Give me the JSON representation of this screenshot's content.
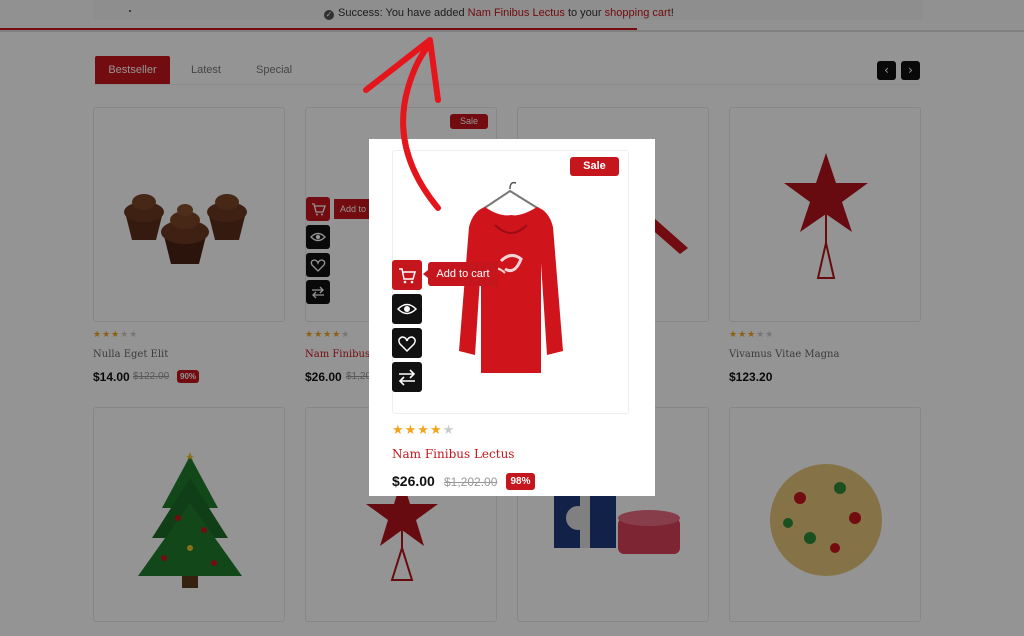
{
  "alert": {
    "prefix": "Success: You have added",
    "product_link": "Nam Finibus Lectus",
    "middle": "to your",
    "cart_link": "shopping cart",
    "suffix": "!"
  },
  "tabs": [
    {
      "label": "Bestseller"
    },
    {
      "label": "Latest"
    },
    {
      "label": "Special"
    }
  ],
  "nav": {
    "prev": "‹",
    "next": "›"
  },
  "products": [
    {
      "name": "Nulla Eget Elit",
      "price": "$14.00",
      "old_price": "$122.00",
      "discount": "90%",
      "rating": 3
    },
    {
      "name": "Nam Finibus",
      "price": "$26.00",
      "old_price": "$1,20",
      "rating": 4
    },
    {
      "name": "",
      "price": "",
      "rating": 0
    },
    {
      "name": "Vivamus Vitae Magna",
      "price": "$123.20",
      "rating": 3
    }
  ],
  "card_sale_label": "Sale",
  "card_add_label": "Add to",
  "popup": {
    "sale_label": "Sale",
    "add_to_cart": "Add to cart",
    "name": "Nam Finibus Lectus",
    "price": "$26.00",
    "old_price": "$1,202.00",
    "discount": "98%",
    "rating": 4,
    "rating_max": 5
  },
  "colors": {
    "accent": "#c4161c",
    "dark": "#111111",
    "star": "#f2a51c"
  },
  "icons": [
    "check-circle-icon",
    "chevron-left-icon",
    "chevron-right-icon",
    "cart-icon",
    "eye-icon",
    "heart-icon",
    "compare-icon",
    "arrow-annotation"
  ]
}
